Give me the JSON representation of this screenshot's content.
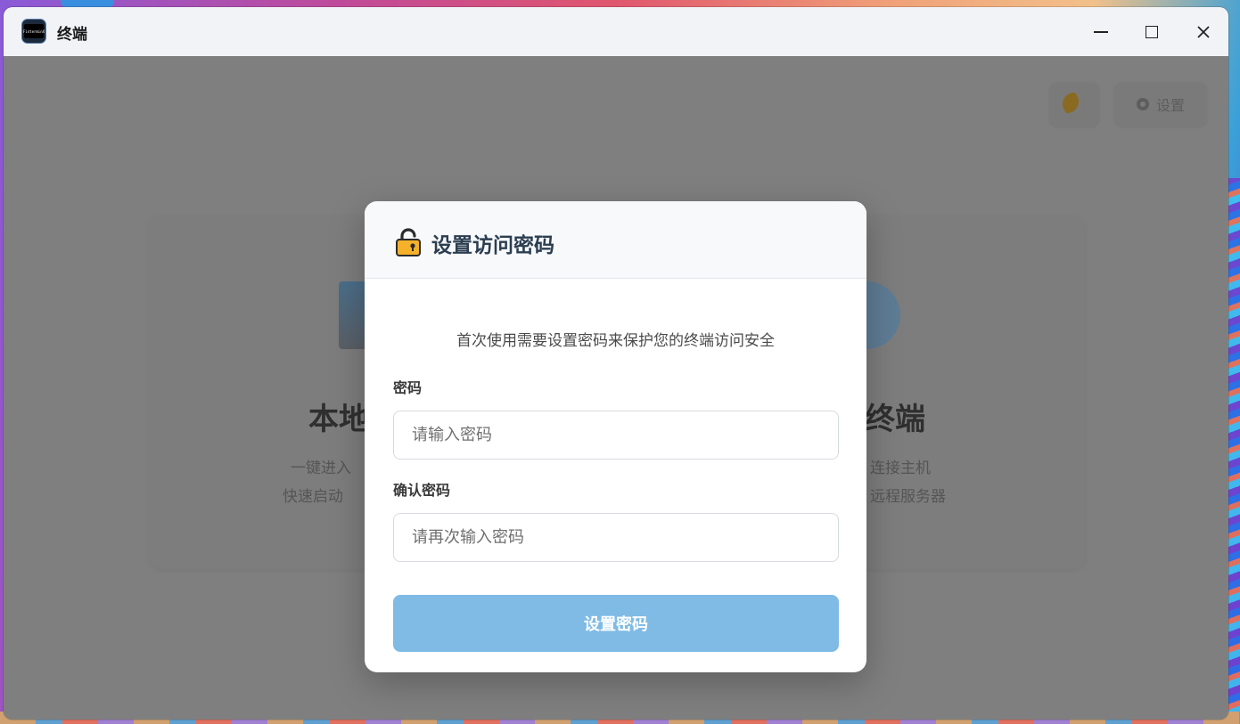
{
  "window": {
    "title": "终端",
    "app_icon_text": "FinterminX",
    "controls": {
      "minimize_icon": "minimize-icon",
      "maximize_icon": "maximize-icon",
      "close_icon": "close-icon"
    }
  },
  "background_page": {
    "theme_icon": "moon-icon",
    "settings_icon": "gear-icon",
    "settings_label": "设置",
    "left_card_title": "本地",
    "left_card_line1": "一键进入",
    "left_card_line2": "快速启动",
    "right_card_title": "终端",
    "right_card_line1": "连接主机",
    "right_card_line2": "远程服务器"
  },
  "dialog": {
    "icon": "lock-icon",
    "title": "设置访问密码",
    "description": "首次使用需要设置密码来保护您的终端访问安全",
    "password_label": "密码",
    "password_placeholder": "请输入密码",
    "confirm_label": "确认密码",
    "confirm_placeholder": "请再次输入密码",
    "submit_label": "设置密码"
  },
  "colors": {
    "accent": "#7fbbe5",
    "title_text": "#2c3e50",
    "overlay": "#7f7f7f"
  }
}
